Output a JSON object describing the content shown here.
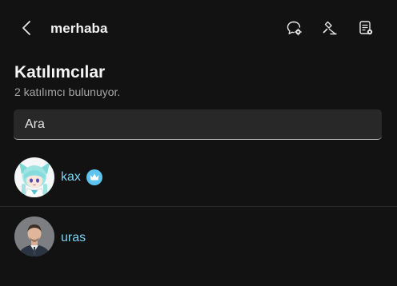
{
  "header": {
    "title": "merhaba",
    "icons": [
      "back-arrow-icon",
      "chat-settings-icon",
      "moderation-gavel-icon",
      "notes-list-icon"
    ]
  },
  "participants_panel": {
    "title": "Katılımcılar",
    "subtitle": "2 katılımcı bulunuyor.",
    "search": {
      "placeholder": "Ara",
      "value": ""
    },
    "items": [
      {
        "name": "kax",
        "badge": "crown-badge-icon",
        "avatar": "anime-character-avatar"
      },
      {
        "name": "uras",
        "avatar": "man-in-suit-avatar"
      }
    ]
  },
  "colors": {
    "background": "#121212",
    "name_accent": "#7ad3f5",
    "badge": "#5cc4ef",
    "search_bg": "#282828"
  }
}
